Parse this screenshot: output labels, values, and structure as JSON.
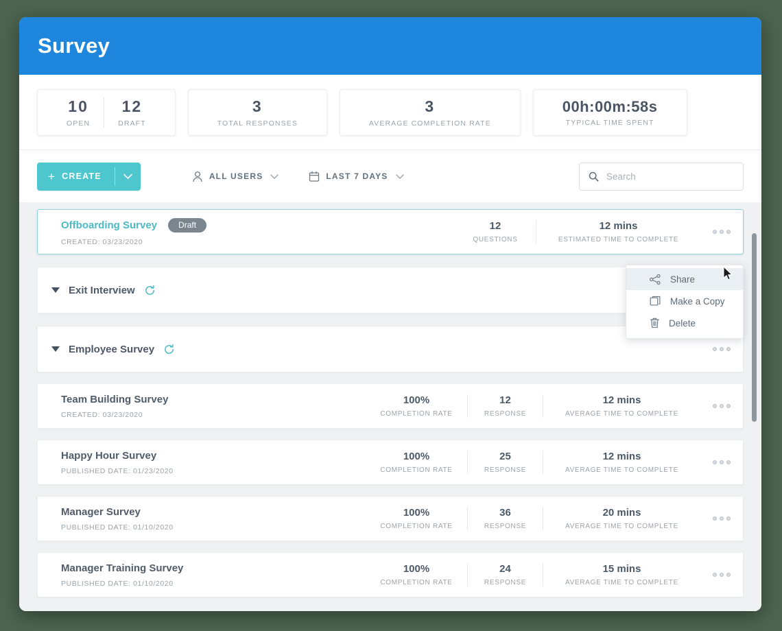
{
  "header": {
    "title": "Survey"
  },
  "stats": [
    {
      "cells": [
        {
          "value": "10",
          "label": "OPEN"
        },
        {
          "value": "12",
          "label": "DRAFT"
        }
      ]
    },
    {
      "cells": [
        {
          "value": "3",
          "label": "TOTAL RESPONSES"
        }
      ]
    },
    {
      "cells": [
        {
          "value": "3",
          "label": "AVERAGE COMPLETION RATE"
        }
      ]
    },
    {
      "cells": [
        {
          "value": "00h:00m:58s",
          "label": "TYPICAL TIME SPENT"
        }
      ]
    }
  ],
  "toolbar": {
    "create_label": "CREATE",
    "create_icon": "plus-icon",
    "create_caret_icon": "chevron-down-icon",
    "filters": [
      {
        "icon": "user-icon",
        "label": "ALL USERS",
        "caret": "chevron-down-icon"
      },
      {
        "icon": "calendar-icon",
        "label": "LAST 7 DAYS",
        "caret": "chevron-down-icon"
      }
    ],
    "search": {
      "placeholder": "Search",
      "value": "",
      "icon": "search-icon"
    }
  },
  "list": {
    "featured_row": {
      "title": "Offboarding Survey",
      "badge": "Draft",
      "subtitle": "CREATED: 03/23/2020",
      "stats": [
        {
          "value": "12",
          "label": "QUESTIONS"
        },
        {
          "value": "12 mins",
          "label": "ESTIMATED TIME TO COMPLETE"
        }
      ]
    },
    "groups": [
      {
        "title": "Exit Interview",
        "icon": "recurring-icon",
        "caret": "caret-down-icon"
      },
      {
        "title": "Employee Survey",
        "icon": "recurring-icon",
        "caret": "caret-down-icon"
      }
    ],
    "rows": [
      {
        "title": "Team Building Survey",
        "subtitle": "CREATED: 03/23/2020",
        "completion_rate": "100%",
        "completion_label": "COMPLETION RATE",
        "responses": "12",
        "responses_label": "RESPONSE",
        "avg_time": "12 mins",
        "avg_time_label": "AVERAGE TIME TO COMPLETE"
      },
      {
        "title": "Happy Hour Survey",
        "subtitle": "PUBLISHED DATE: 01/23/2020",
        "completion_rate": "100%",
        "completion_label": "COMPLETION RATE",
        "responses": "25",
        "responses_label": "RESPONSE",
        "avg_time": "12 mins",
        "avg_time_label": "AVERAGE TIME TO COMPLETE"
      },
      {
        "title": "Manager Survey",
        "subtitle": "PUBLISHED DATE: 01/10/2020",
        "completion_rate": "100%",
        "completion_label": "COMPLETION RATE",
        "responses": "36",
        "responses_label": "RESPONSE",
        "avg_time": "20 mins",
        "avg_time_label": "AVERAGE TIME TO COMPLETE"
      },
      {
        "title": "Manager Training Survey",
        "subtitle": "PUBLISHED DATE: 01/10/2020",
        "completion_rate": "100%",
        "completion_label": "COMPLETION RATE",
        "responses": "24",
        "responses_label": "RESPONSE",
        "avg_time": "15 mins",
        "avg_time_label": "AVERAGE TIME TO COMPLETE"
      }
    ]
  },
  "context_menu": {
    "items": [
      {
        "label": "Share",
        "icon": "share-icon",
        "hovered": true
      },
      {
        "label": "Make a Copy",
        "icon": "copy-icon",
        "hovered": false
      },
      {
        "label": "Delete",
        "icon": "trash-icon",
        "hovered": false
      }
    ]
  },
  "colors": {
    "header_blue": "#1e87dd",
    "accent_teal": "#4ec6cd",
    "badge_grey": "#7b858e",
    "page_background": "#4c6450",
    "list_background": "#eff1f3"
  }
}
